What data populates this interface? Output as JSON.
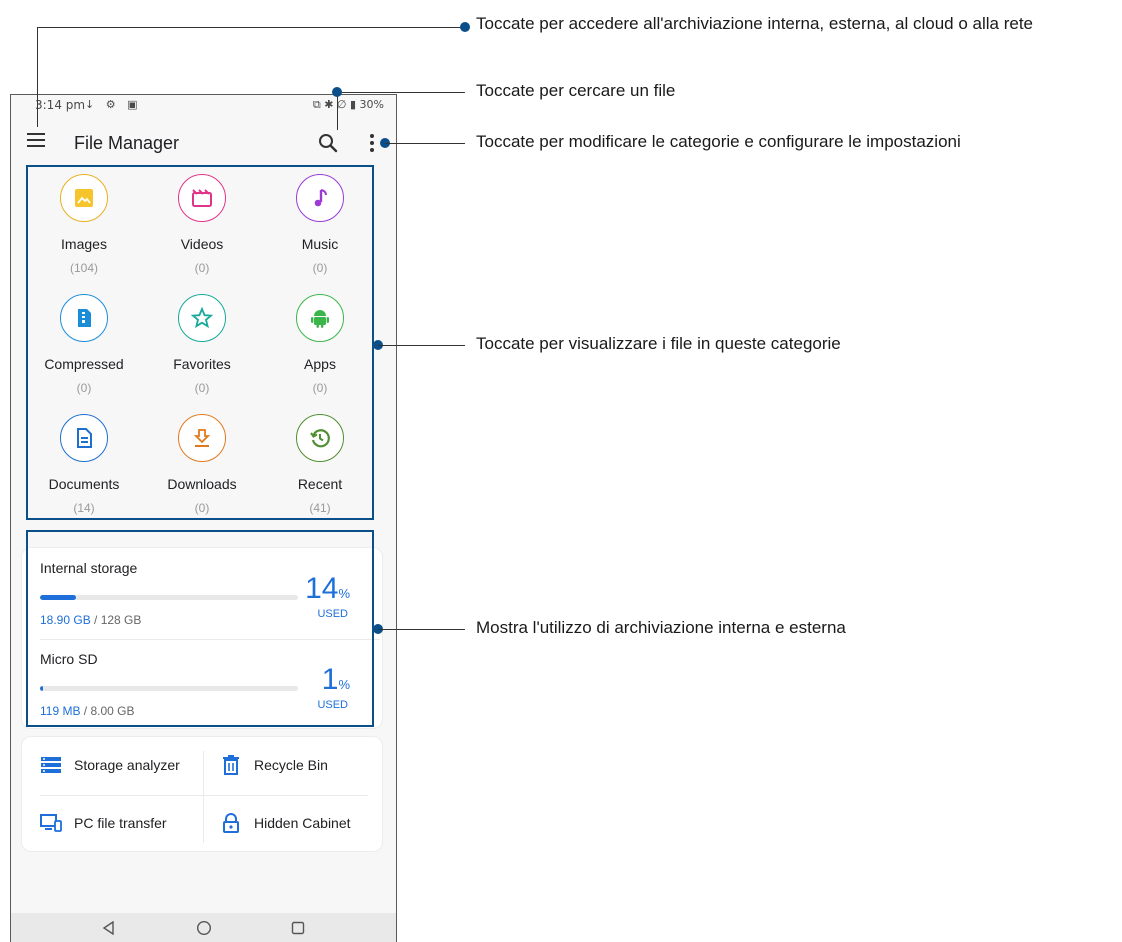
{
  "status": {
    "time": "3:14 pm",
    "icons_left": "↓ ⚙ ▣",
    "icons_right": "⧉ ✱ ∅ ▮ 30%"
  },
  "appbar": {
    "title": "File Manager"
  },
  "categories": [
    {
      "label": "Images",
      "count": "(104)",
      "icon": "image-icon",
      "color": "#e8b021"
    },
    {
      "label": "Videos",
      "count": "(0)",
      "icon": "video-icon",
      "color": "#e0348a"
    },
    {
      "label": "Music",
      "count": "(0)",
      "icon": "music-icon",
      "color": "#9c3bd6"
    },
    {
      "label": "Compressed",
      "count": "(0)",
      "icon": "compressed-icon",
      "color": "#1b8dd8"
    },
    {
      "label": "Favorites",
      "count": "(0)",
      "icon": "star-icon",
      "color": "#17a99a"
    },
    {
      "label": "Apps",
      "count": "(0)",
      "icon": "android-icon",
      "color": "#3bb54a"
    },
    {
      "label": "Documents",
      "count": "(14)",
      "icon": "document-icon",
      "color": "#1f6fd0"
    },
    {
      "label": "Downloads",
      "count": "(0)",
      "icon": "download-icon",
      "color": "#e07a1f"
    },
    {
      "label": "Recent",
      "count": "(41)",
      "icon": "history-icon",
      "color": "#4f8f2f"
    }
  ],
  "storage": [
    {
      "name": "Internal storage",
      "used": "18.90 GB",
      "total": " / 128 GB",
      "percent": "14",
      "percent_value": 14,
      "pct_sign": "%",
      "used_label": "USED"
    },
    {
      "name": "Micro SD",
      "used": "119 MB",
      "total": " / 8.00 GB",
      "percent": "1",
      "percent_value": 1,
      "pct_sign": "%",
      "used_label": "USED"
    }
  ],
  "tools": {
    "storage_analyzer": "Storage analyzer",
    "recycle_bin": "Recycle Bin",
    "pc_file_transfer": "PC file transfer",
    "hidden_cabinet": "Hidden Cabinet"
  },
  "callouts": {
    "menu": "Toccate per accedere all'archiviazione interna, esterna, al cloud o alla rete",
    "search": "Toccate per cercare un file",
    "more": "Toccate per modificare le categorie e configurare le impostazioni",
    "categories": "Toccate per visualizzare i file in queste categorie",
    "storage": "Mostra l'utilizzo di archiviazione interna e esterna"
  },
  "colors": {
    "accent": "#1e6fd9",
    "highlight": "#0b4f8a"
  }
}
